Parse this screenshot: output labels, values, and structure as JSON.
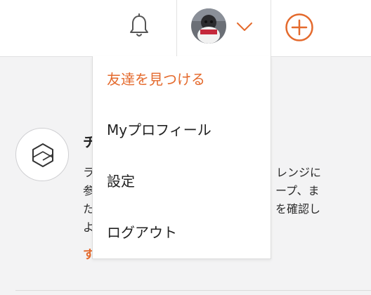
{
  "colors": {
    "accent": "#e46a2d",
    "icon_gray": "#555555"
  },
  "header": {
    "notifications_icon": "bell-icon",
    "account_menu_icon": "chevron-down-icon",
    "create_icon": "plus-circle-icon"
  },
  "account_menu": {
    "items": [
      {
        "label": "友達を見つける",
        "active": true
      },
      {
        "label": "Myプロフィール",
        "active": false
      },
      {
        "label": "設定",
        "active": false
      },
      {
        "label": "ログアウト",
        "active": false
      }
    ]
  },
  "background_card": {
    "icon": "hexagon-icon",
    "title_fragment": "チ",
    "left_fragments": [
      "ラ",
      "参",
      "た",
      "よ"
    ],
    "right_fragments": [
      "レンジに",
      "ープ、ま",
      "を確認し"
    ],
    "link_fragment": "す"
  }
}
